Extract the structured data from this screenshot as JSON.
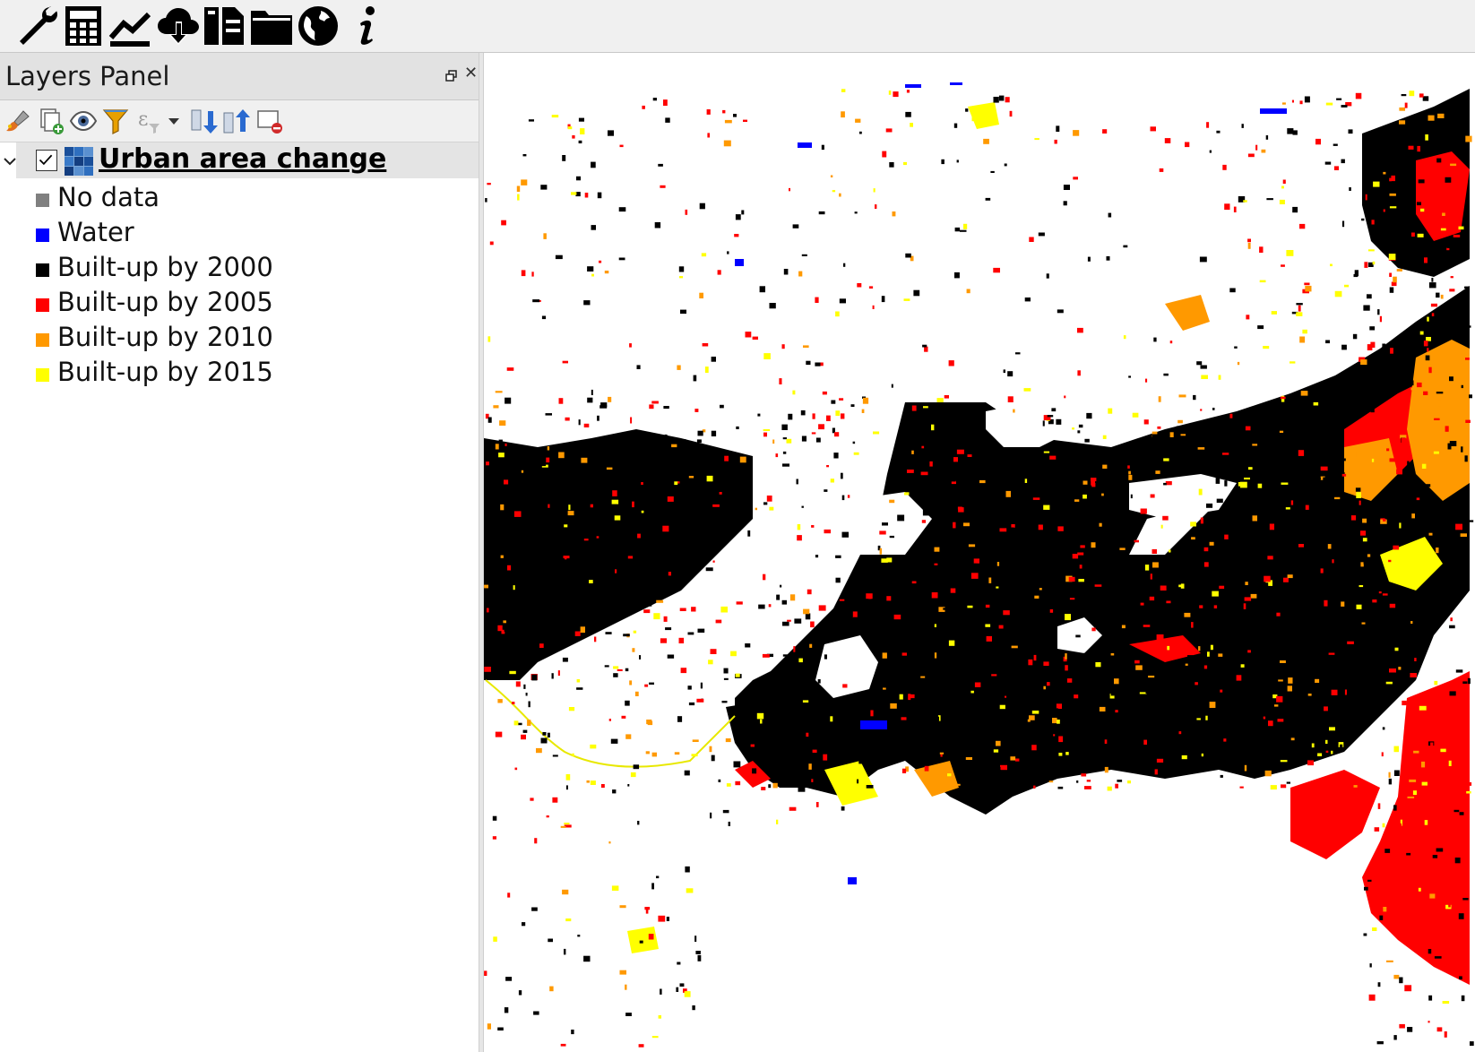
{
  "toolbar": {
    "tools": [
      {
        "icon": "wrench-icon"
      },
      {
        "icon": "calculator-icon"
      },
      {
        "icon": "line-chart-icon"
      },
      {
        "icon": "cloud-download-icon"
      },
      {
        "icon": "layout-icon"
      },
      {
        "icon": "folder-icon"
      },
      {
        "icon": "globe-icon"
      },
      {
        "icon": "info-icon"
      }
    ]
  },
  "layers_panel": {
    "title": "Layers Panel",
    "toolbar_icons": [
      "style-brush-icon",
      "add-group-icon",
      "visibility-eye-icon",
      "filter-icon",
      "expression-filter-icon",
      "dropdown-arrow-icon",
      "expand-all-icon",
      "collapse-all-icon",
      "remove-layer-icon"
    ],
    "layer": {
      "name": "Urban area change",
      "checked": true,
      "expanded": true,
      "legend": [
        {
          "label": "No data",
          "color": "#808080"
        },
        {
          "label": "Water",
          "color": "#0000ff"
        },
        {
          "label": "Built-up by 2000",
          "color": "#000000"
        },
        {
          "label": "Built-up by 2005",
          "color": "#ff0000"
        },
        {
          "label": "Built-up by 2010",
          "color": "#ff9900"
        },
        {
          "label": "Built-up by 2015",
          "color": "#ffff00"
        }
      ]
    }
  },
  "map": {
    "background": "#ffffff"
  }
}
